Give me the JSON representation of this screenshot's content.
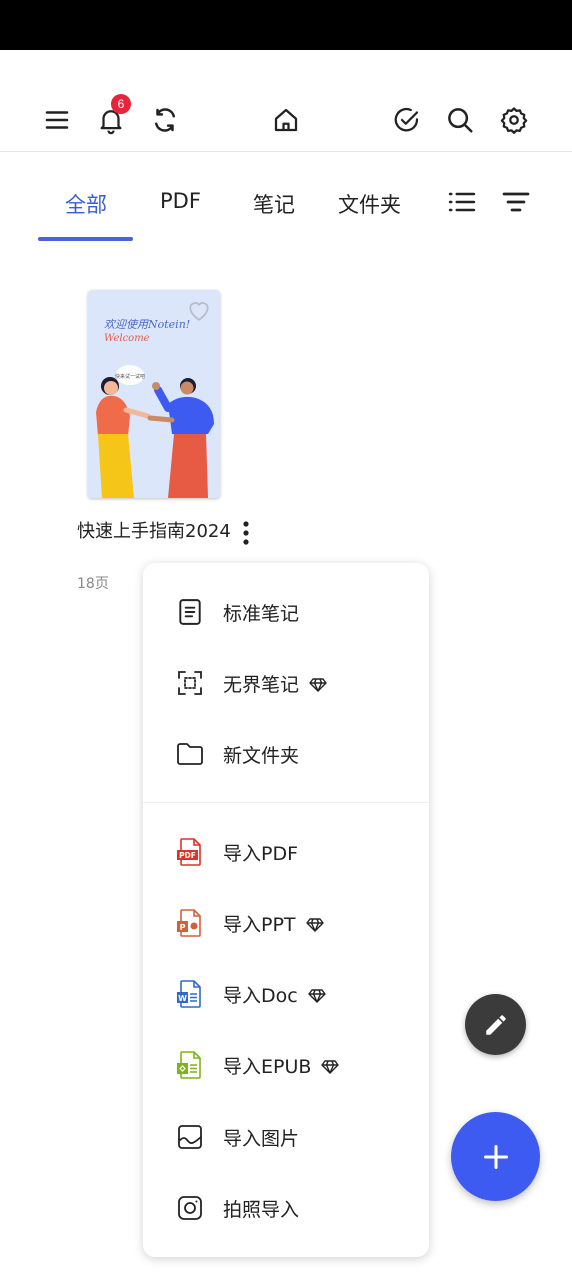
{
  "toolbar": {
    "notification_count": "6"
  },
  "tabs": [
    {
      "label": "全部",
      "active": true
    },
    {
      "label": "PDF",
      "active": false
    },
    {
      "label": "笔记",
      "active": false
    },
    {
      "label": "文件夹",
      "active": false
    }
  ],
  "document": {
    "name": "快速上手指南2024",
    "pages": "18页",
    "thumbnail": {
      "title": "欢迎使用Notein!",
      "welcome": "Welcome",
      "bubble": "快来试一试吧"
    }
  },
  "menu": {
    "items": [
      {
        "label": "标准笔记",
        "icon": "note-icon",
        "pro": false
      },
      {
        "label": "无界笔记",
        "icon": "infinite-canvas-icon",
        "pro": true
      },
      {
        "label": "新文件夹",
        "icon": "folder-icon",
        "pro": false
      },
      {
        "label": "导入PDF",
        "icon": "pdf-file-icon",
        "pro": false
      },
      {
        "label": "导入PPT",
        "icon": "ppt-file-icon",
        "pro": true
      },
      {
        "label": "导入Doc",
        "icon": "word-file-icon",
        "pro": true
      },
      {
        "label": "导入EPUB",
        "icon": "epub-file-icon",
        "pro": true
      },
      {
        "label": "导入图片",
        "icon": "image-icon",
        "pro": false
      },
      {
        "label": "拍照导入",
        "icon": "camera-icon",
        "pro": false
      }
    ]
  },
  "colors": {
    "accent": "#3a5bd9",
    "fab_primary": "#3d5af1",
    "fab_secondary": "#3b3b3b",
    "badge": "#e8243c",
    "pdf": "#d9342b",
    "ppt": "#d2603a",
    "word": "#2f6bc4",
    "epub": "#7cb518"
  }
}
